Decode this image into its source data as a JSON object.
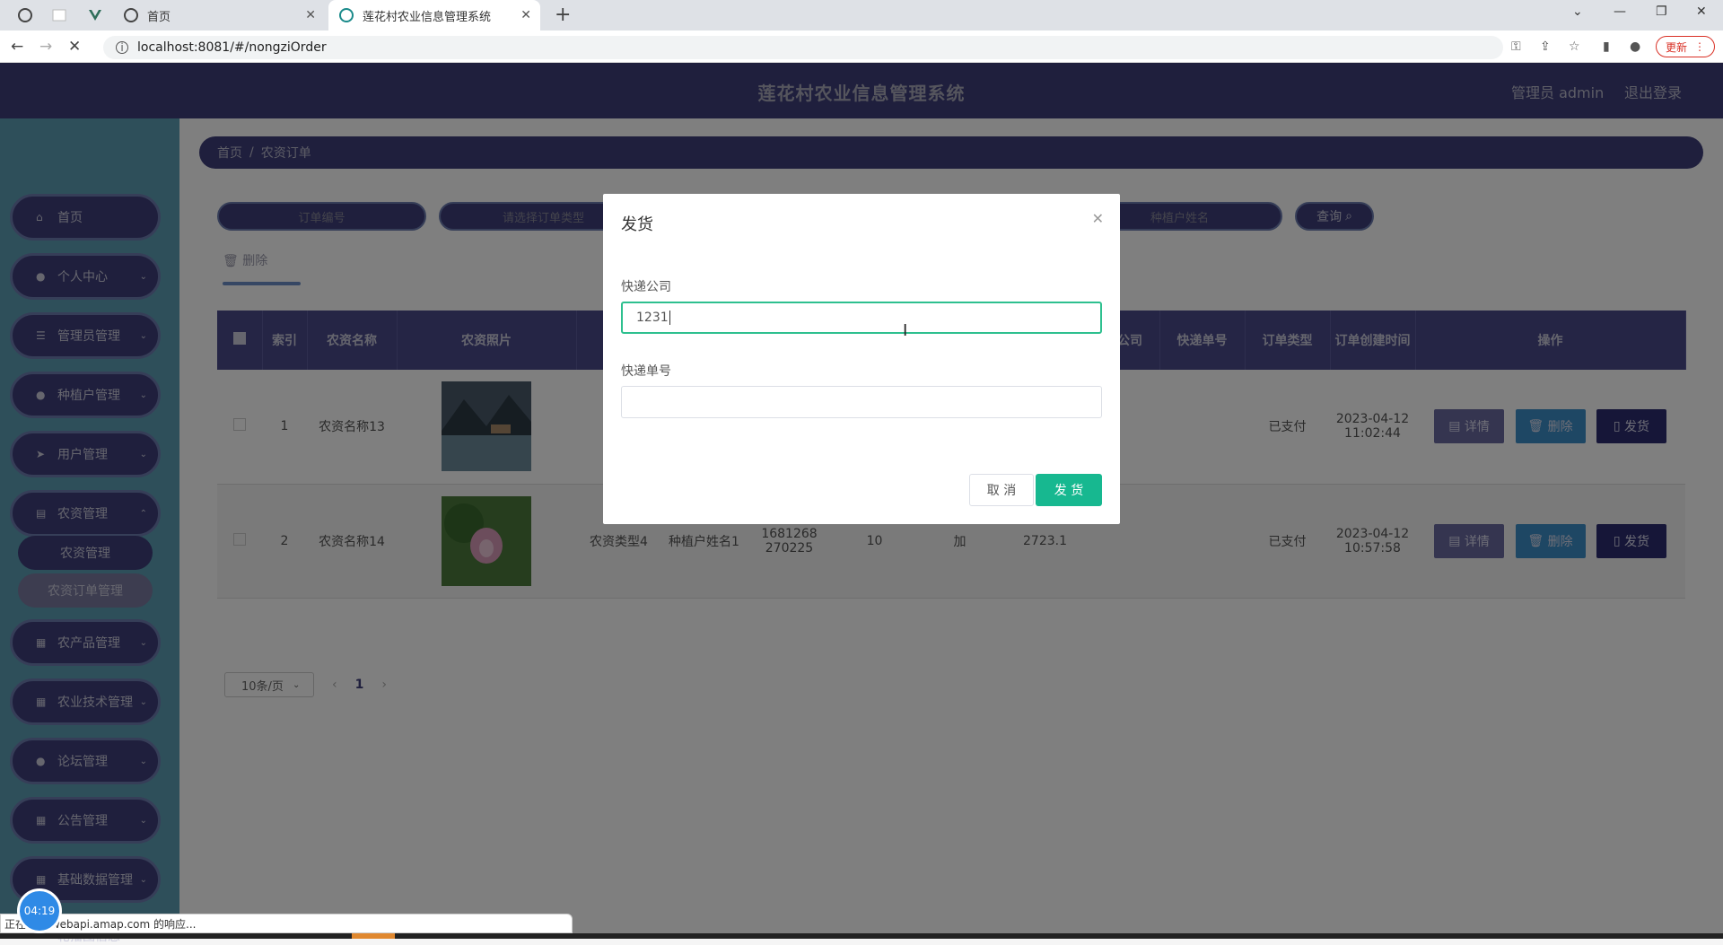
{
  "browser": {
    "tabs": [
      {
        "label": "首页"
      },
      {
        "label": "莲花村农业信息管理系统"
      }
    ],
    "url": "localhost:8081/#/nongziOrder",
    "update_label": "更新",
    "status_text": "正在等待 webapi.amap.com 的响应...",
    "clock": "04:19"
  },
  "app": {
    "title": "莲花村农业信息管理系统",
    "user": "管理员 admin",
    "logout": "退出登录"
  },
  "sidebar": {
    "items": [
      {
        "label": "首页",
        "icon": "home-icon"
      },
      {
        "label": "个人中心",
        "icon": "user-icon"
      },
      {
        "label": "管理员管理",
        "icon": "list-icon"
      },
      {
        "label": "种植户管理",
        "icon": "user-icon"
      },
      {
        "label": "用户管理",
        "icon": "send-icon"
      },
      {
        "label": "农资管理",
        "icon": "bank-icon"
      },
      {
        "label": "农产品管理",
        "icon": "grid-icon"
      },
      {
        "label": "农业技术管理",
        "icon": "grid-icon"
      },
      {
        "label": "论坛管理",
        "icon": "user-icon"
      },
      {
        "label": "公告管理",
        "icon": "grid-icon"
      },
      {
        "label": "基础数据管理",
        "icon": "grid-icon"
      },
      {
        "label": "轮播图信息",
        "icon": "grid-icon"
      }
    ],
    "sub_items": [
      {
        "label": "农资管理"
      },
      {
        "label": "农资订单管理"
      }
    ]
  },
  "breadcrumb": {
    "home": "首页",
    "sep": "/",
    "current": "农资订单"
  },
  "search": {
    "order_no_placeholder": "订单编号",
    "order_type_placeholder": "请选择订单类型",
    "planter_name_placeholder": "种植户姓名",
    "query_label": "查询"
  },
  "toolbar": {
    "delete_label": "删除"
  },
  "table": {
    "headers": [
      "",
      "索引",
      "农资名称",
      "农资照片",
      "农",
      "",
      "",
      "",
      "",
      "",
      "递公司",
      "快递单号",
      "订单类型",
      "订单创建时间",
      "操作"
    ],
    "rows": [
      {
        "index": "1",
        "name": "农资名称13",
        "type": "农",
        "planter": "",
        "phone": "",
        "qty": "",
        "addr": "",
        "price": "",
        "status": "已支付",
        "created": "2023-04-12 11:02:44"
      },
      {
        "index": "2",
        "name": "农资名称14",
        "type": "农资类型4",
        "planter": "种植户姓名1",
        "phone": "1681268270225",
        "qty": "10",
        "addr": "加",
        "price": "2723.1",
        "status": "已支付",
        "created": "2023-04-12 10:57:58"
      }
    ],
    "actions": {
      "detail": "详情",
      "delete": "删除",
      "ship": "发货"
    }
  },
  "pager": {
    "page_size": "10条/页",
    "current_page": "1"
  },
  "dialog": {
    "title": "发货",
    "company_label": "快递公司",
    "company_value": "1231",
    "tracking_label": "快递单号",
    "tracking_value": "",
    "cancel_label": "取 消",
    "ok_label": "发 货"
  }
}
